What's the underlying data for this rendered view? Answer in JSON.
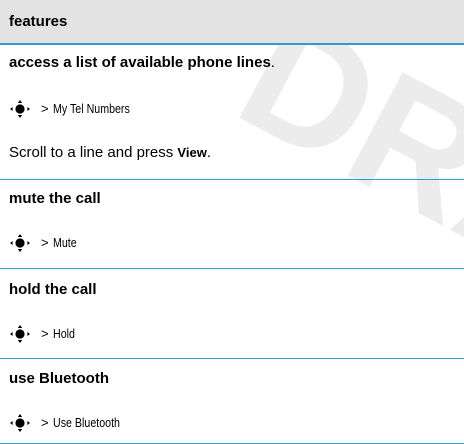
{
  "watermark": {
    "text": "DRA",
    "color": "#e6e6e6"
  },
  "header": {
    "label": "features",
    "background": "#e3e3e3"
  },
  "rule_color": "#2a9fd6",
  "sections": [
    {
      "title": "access a list of available phone lines",
      "title_suffix": ".",
      "path_prefix_icon": "nav-key-icon",
      "path_separator": ">",
      "path_command": "My Tel Numbers",
      "note_before": "Scroll to a line and press ",
      "note_keyword": "View",
      "note_after": "."
    },
    {
      "title": "mute the call",
      "path_prefix_icon": "nav-key-icon",
      "path_separator": ">",
      "path_command": "Mute"
    },
    {
      "title": "hold the call",
      "path_prefix_icon": "nav-key-icon",
      "path_separator": ">",
      "path_command": "Hold"
    },
    {
      "title": "use Bluetooth",
      "path_prefix_icon": "nav-key-icon",
      "path_separator": ">",
      "path_command": "Use Bluetooth"
    }
  ]
}
